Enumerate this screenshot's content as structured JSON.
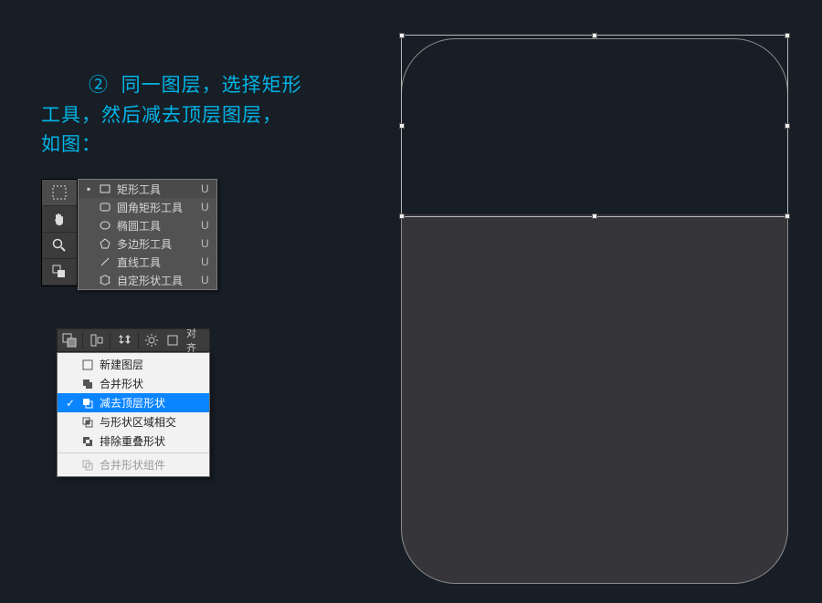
{
  "instruction": {
    "step_marker": "②",
    "text_line1": "同一图层，选择矩形",
    "text_line2": "工具，然后减去顶层图层，",
    "text_line3": "如图："
  },
  "shape_tools": {
    "items": [
      {
        "label": "矩形工具",
        "shortcut": "U",
        "icon": "rect-icon",
        "selected": true
      },
      {
        "label": "圆角矩形工具",
        "shortcut": "U",
        "icon": "rounded-rect-icon",
        "selected": false
      },
      {
        "label": "椭圆工具",
        "shortcut": "U",
        "icon": "ellipse-icon",
        "selected": false
      },
      {
        "label": "多边形工具",
        "shortcut": "U",
        "icon": "polygon-icon",
        "selected": false
      },
      {
        "label": "直线工具",
        "shortcut": "U",
        "icon": "line-icon",
        "selected": false
      },
      {
        "label": "自定形状工具",
        "shortcut": "U",
        "icon": "custom-shape-icon",
        "selected": false
      }
    ]
  },
  "options_bar": {
    "align_label": "对齐"
  },
  "path_ops_menu": {
    "items": [
      {
        "label": "新建图层",
        "icon": "new-layer-icon",
        "checked": false
      },
      {
        "label": "合并形状",
        "icon": "combine-icon",
        "checked": false
      },
      {
        "label": "减去顶层形状",
        "icon": "subtract-icon",
        "checked": true
      },
      {
        "label": "与形状区域相交",
        "icon": "intersect-icon",
        "checked": false
      },
      {
        "label": "排除重叠形状",
        "icon": "exclude-icon",
        "checked": false
      }
    ],
    "footer": {
      "label": "合并形状组件",
      "icon": "merge-components-icon"
    }
  }
}
